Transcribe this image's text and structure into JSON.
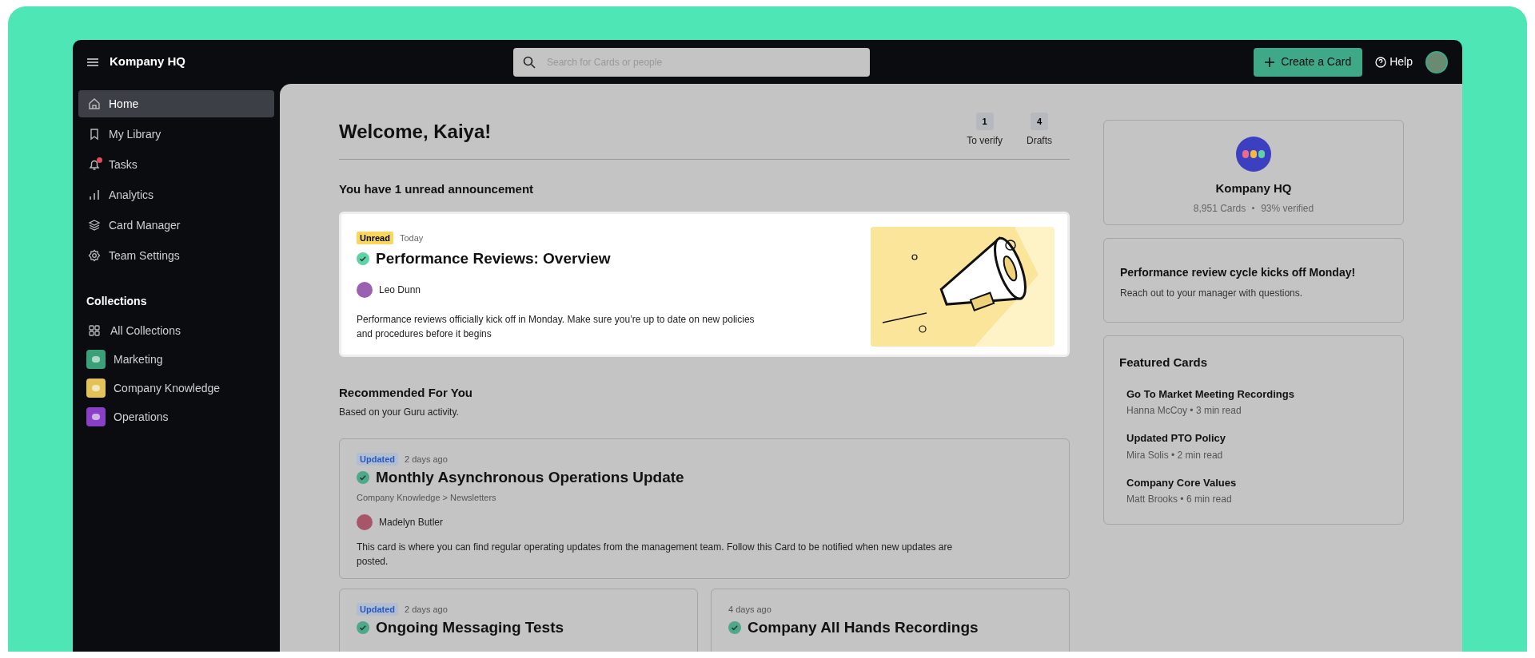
{
  "app": {
    "title": "Kompany HQ"
  },
  "search": {
    "placeholder": "Search for Cards or people"
  },
  "topbar": {
    "create_button": "Create a Card",
    "help": "Help"
  },
  "sidebar": {
    "items": [
      {
        "label": "Home",
        "selected": true,
        "notification": false
      },
      {
        "label": "My Library",
        "selected": false,
        "notification": false
      },
      {
        "label": "Tasks",
        "selected": false,
        "notification": true
      },
      {
        "label": "Analytics",
        "selected": false,
        "notification": false
      },
      {
        "label": "Card Manager",
        "selected": false,
        "notification": false
      },
      {
        "label": "Team Settings",
        "selected": false,
        "notification": false
      }
    ],
    "collections_heading": "Collections",
    "collections": [
      {
        "label": "All Collections",
        "kind": "grid"
      },
      {
        "label": "Marketing",
        "kind": "tile",
        "color": "#3aa07a"
      },
      {
        "label": "Company Knowledge",
        "kind": "tile",
        "color": "#e3c25a"
      },
      {
        "label": "Operations",
        "kind": "tile",
        "color": "#8a3fc7"
      }
    ]
  },
  "welcome": {
    "title": "Welcome, Kaiya!",
    "stats": [
      {
        "count": "1",
        "label": "To verify"
      },
      {
        "count": "4",
        "label": "Drafts"
      }
    ]
  },
  "announcement": {
    "heading": "You have 1 unread announcement",
    "badge": "Unread",
    "date": "Today",
    "title": "Performance Reviews: Overview",
    "author": "Leo Dunn",
    "body": "Performance reviews officially kick off in Monday. Make sure you’re up to date on new policies and procedures before it begins"
  },
  "recommended": {
    "title": "Recommended For You",
    "subtitle": "Based on your Guru activity.",
    "cards": [
      {
        "badge": "Updated",
        "date": "2 days ago",
        "title": "Monthly Asynchronous Operations Update",
        "path": "Company Knowledge > Newsletters",
        "author": "Madelyn Butler",
        "body": "This card is where you can find regular operating updates from the management team. Follow this Card to be notified when new updates are posted."
      },
      {
        "badge": "Updated",
        "date": "2 days ago",
        "title": "Ongoing Messaging Tests"
      },
      {
        "date": "4 days ago",
        "title": "Company All Hands Recordings"
      }
    ]
  },
  "team": {
    "name": "Kompany HQ",
    "cards": "8,951 Cards",
    "verified": "93% verified"
  },
  "notice": {
    "title": "Performance review cycle kicks off Monday!",
    "body": "Reach out to your manager with questions."
  },
  "featured": {
    "title": "Featured Cards",
    "items": [
      {
        "title": "Go To Market Meeting Recordings",
        "meta": "Hanna McCoy • 3 min read"
      },
      {
        "title": "Updated PTO Policy",
        "meta": "Mira Solis • 2 min read"
      },
      {
        "title": "Company Core Values",
        "meta": "Matt Brooks • 6 min read"
      }
    ]
  }
}
